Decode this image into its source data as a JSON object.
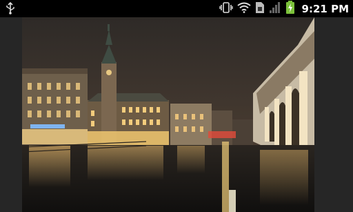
{
  "status_bar": {
    "time": "9:21 PM",
    "icons": [
      "usb-debugging-icon",
      "vibrate-icon",
      "wifi-icon",
      "sim-card-icon",
      "signal-icon",
      "battery-charging-icon"
    ],
    "battery_color": "#7cc23b"
  },
  "viewer": {
    "image": {
      "subject": "city-night-photo",
      "colors": {
        "sky": "#3a322c",
        "water": "#171512",
        "lights": "#f2c169",
        "building": "#cfc6b5"
      }
    }
  }
}
